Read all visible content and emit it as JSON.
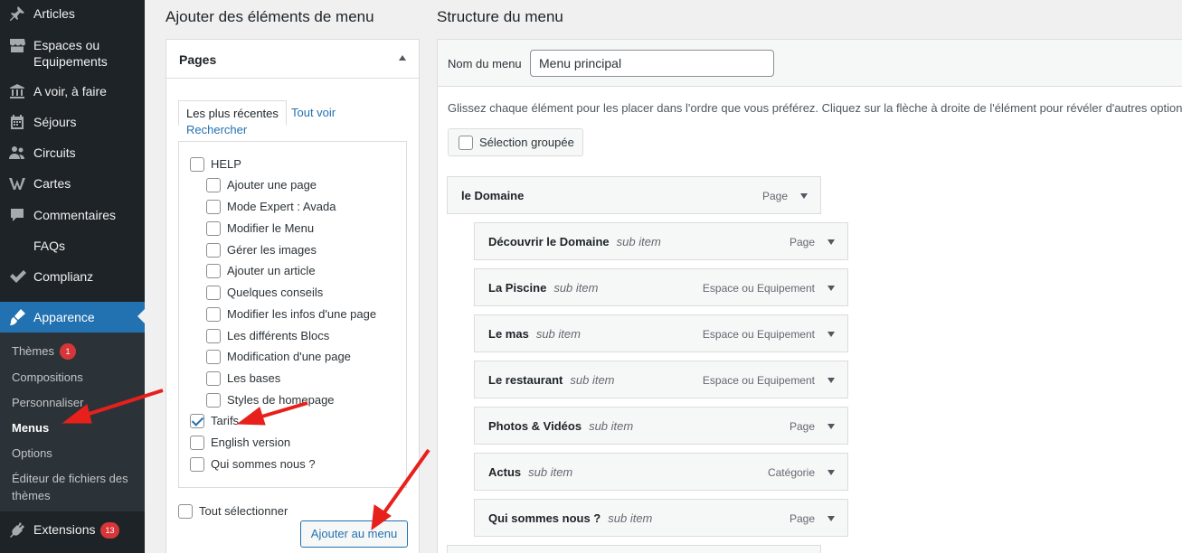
{
  "sidebar": {
    "items": [
      {
        "label": "Articles",
        "icon": "pin-icon"
      },
      {
        "label": "Espaces ou Equipements",
        "icon": "store-icon"
      },
      {
        "label": "A voir, à faire",
        "icon": "bank-icon"
      },
      {
        "label": "Séjours",
        "icon": "calendar-icon"
      },
      {
        "label": "Circuits",
        "icon": "admin-users-icon"
      },
      {
        "label": "Cartes",
        "icon": "w-icon"
      },
      {
        "label": "Commentaires",
        "icon": "comment-icon"
      },
      {
        "label": "FAQs",
        "icon": ""
      },
      {
        "label": "Complianz",
        "icon": "checkmark-icon"
      },
      {
        "label": "Apparence",
        "icon": "brush-icon"
      }
    ],
    "submenu": [
      {
        "label": "Thèmes",
        "badge": "1"
      },
      {
        "label": "Compositions"
      },
      {
        "label": "Personnaliser"
      },
      {
        "label": "Menus"
      },
      {
        "label": "Options"
      },
      {
        "label": "Éditeur de fichiers des thèmes"
      }
    ],
    "extensions": {
      "label": "Extensions",
      "badge": "13"
    }
  },
  "left": {
    "heading": "Ajouter des éléments de menu",
    "panel_title": "Pages",
    "tabs": {
      "recent": "Les plus récentes",
      "all": "Tout voir",
      "search": "Rechercher"
    },
    "pages": [
      {
        "label": "HELP",
        "checked": false,
        "level": 0
      },
      {
        "label": "Ajouter une page",
        "checked": false,
        "level": 1
      },
      {
        "label": "Mode Expert : Avada",
        "checked": false,
        "level": 1
      },
      {
        "label": "Modifier le Menu",
        "checked": false,
        "level": 1
      },
      {
        "label": "Gérer les images",
        "checked": false,
        "level": 1
      },
      {
        "label": "Ajouter un article",
        "checked": false,
        "level": 1
      },
      {
        "label": "Quelques conseils",
        "checked": false,
        "level": 1
      },
      {
        "label": "Modifier les infos d'une page",
        "checked": false,
        "level": 1
      },
      {
        "label": "Les différents Blocs",
        "checked": false,
        "level": 1
      },
      {
        "label": "Modification d'une page",
        "checked": false,
        "level": 1
      },
      {
        "label": "Les bases",
        "checked": false,
        "level": 1
      },
      {
        "label": "Styles de homepage",
        "checked": false,
        "level": 1
      },
      {
        "label": "Tarifs",
        "checked": true,
        "level": 0
      },
      {
        "label": "English version",
        "checked": false,
        "level": 0
      },
      {
        "label": "Qui sommes nous ?",
        "checked": false,
        "level": 0
      }
    ],
    "select_all": "Tout sélectionner",
    "add_button": "Ajouter au menu"
  },
  "right": {
    "heading": "Structure du menu",
    "menu_name_label": "Nom du menu",
    "menu_name_value": "Menu principal",
    "instructions": "Glissez chaque élément pour les placer dans l'ordre que vous préférez. Cliquez sur la flèche à droite de l'élément pour révéler d'autres options",
    "bulk_select": "Sélection groupée",
    "items": [
      {
        "title": "le Domaine",
        "sub": "",
        "type": "Page"
      },
      {
        "title": "Découvrir le Domaine",
        "sub": "sub item",
        "type": "Page"
      },
      {
        "title": "La Piscine",
        "sub": "sub item",
        "type": "Espace ou Equipement"
      },
      {
        "title": "Le mas",
        "sub": "sub item",
        "type": "Espace ou Equipement"
      },
      {
        "title": "Le restaurant",
        "sub": "sub item",
        "type": "Espace ou Equipement"
      },
      {
        "title": "Photos & Vidéos",
        "sub": "sub item",
        "type": "Page"
      },
      {
        "title": "Actus",
        "sub": "sub item",
        "type": "Catégorie"
      },
      {
        "title": "Qui sommes nous ?",
        "sub": "sub item",
        "type": "Page"
      }
    ]
  },
  "colors": {
    "accent": "#2271b1",
    "sidebar": "#1d2327",
    "annotation": "#e8201c"
  }
}
